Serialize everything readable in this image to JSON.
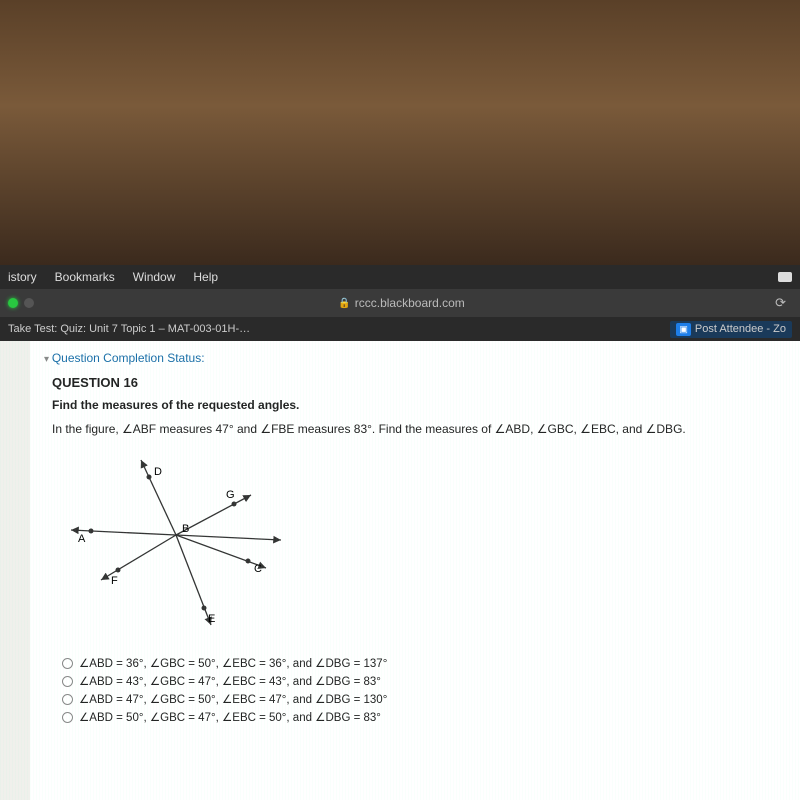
{
  "menubar": {
    "items": [
      "istory",
      "Bookmarks",
      "Window",
      "Help"
    ]
  },
  "address": {
    "host": "rccc.blackboard.com"
  },
  "tabs": {
    "left": "Take Test: Quiz: Unit 7 Topic 1 – MAT-003-01H-…",
    "right": "Post Attendee - Zo"
  },
  "status_label": "Question Completion Status:",
  "question_number": "QUESTION 16",
  "prompt": "Find the measures of the requested angles.",
  "description": "In the figure, ∠ABF measures 47° and ∠FBE measures 83°. Find the measures of ∠ABD, ∠GBC, ∠EBC, and ∠DBG.",
  "figure": {
    "points": [
      "A",
      "B",
      "C",
      "D",
      "E",
      "F",
      "G"
    ]
  },
  "options": [
    "∠ABD = 36°, ∠GBC = 50°, ∠EBC = 36°, and ∠DBG = 137°",
    "∠ABD = 43°, ∠GBC = 47°, ∠EBC = 43°, and ∠DBG = 83°",
    "∠ABD = 47°, ∠GBC = 50°, ∠EBC = 47°, and ∠DBG = 130°",
    "∠ABD = 50°, ∠GBC = 47°, ∠EBC = 50°, and ∠DBG = 83°"
  ]
}
